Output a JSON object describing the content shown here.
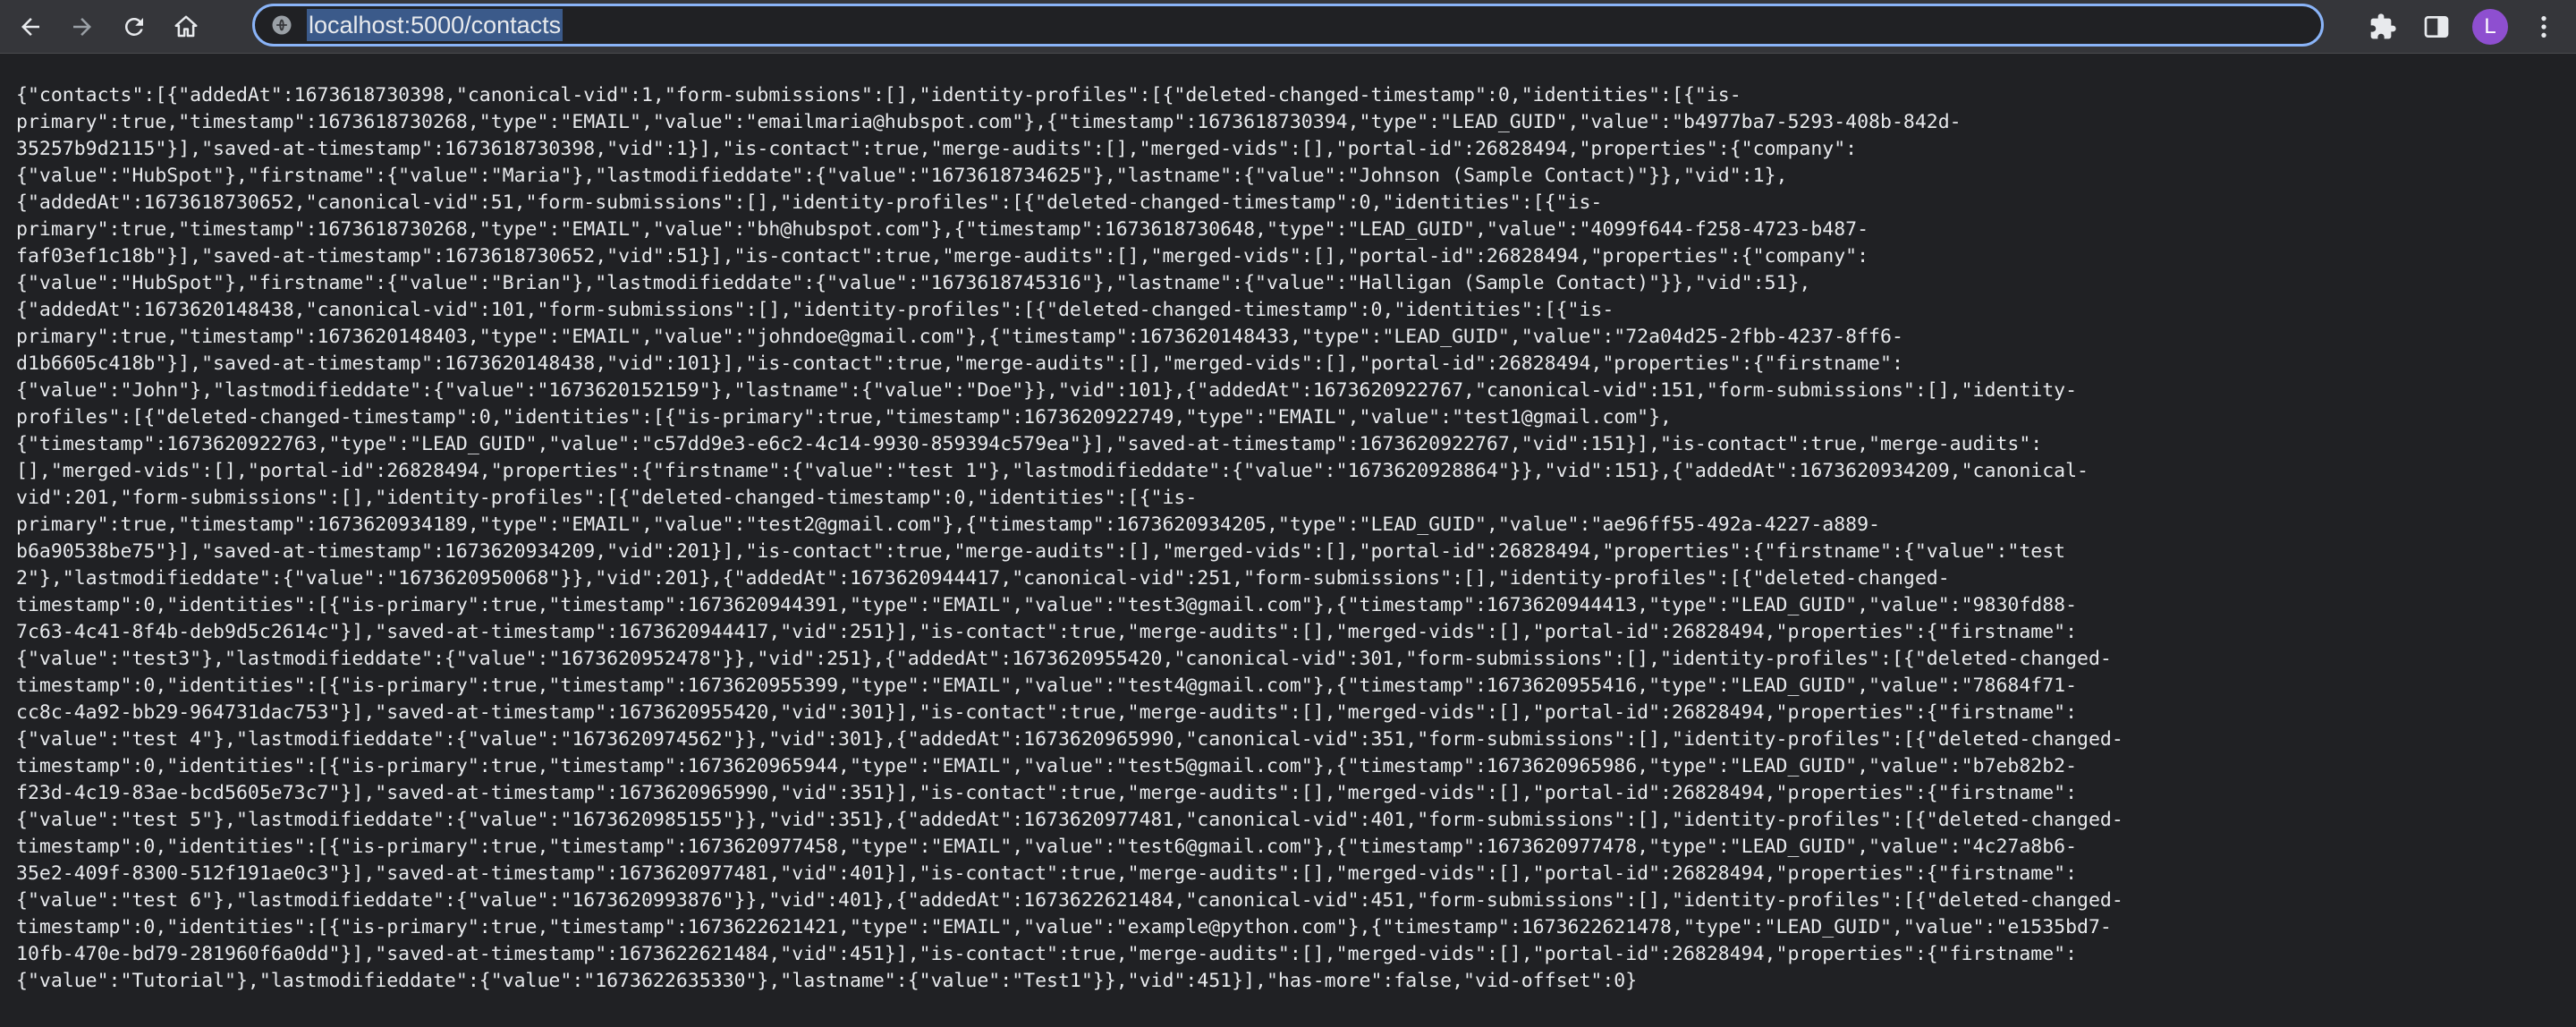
{
  "browser": {
    "url": "localhost:5000/contacts",
    "avatar_letter": "L",
    "icons": {
      "back": "back-arrow-icon",
      "forward": "forward-arrow-icon",
      "reload": "reload-icon",
      "home": "home-icon",
      "site_info": "site-info-icon",
      "extensions": "puzzle-piece-icon",
      "side_panel": "side-panel-icon",
      "menu": "kebab-menu-icon"
    }
  },
  "page": {
    "lines": [
      "{\"contacts\":[{\"addedAt\":1673618730398,\"canonical-vid\":1,\"form-submissions\":[],\"identity-profiles\":[{\"deleted-changed-timestamp\":0,\"identities\":[{\"is-",
      "primary\":true,\"timestamp\":1673618730268,\"type\":\"EMAIL\",\"value\":\"emailmaria@hubspot.com\"},{\"timestamp\":1673618730394,\"type\":\"LEAD_GUID\",\"value\":\"b4977ba7-5293-408b-842d-",
      "35257b9d2115\"}],\"saved-at-timestamp\":1673618730398,\"vid\":1}],\"is-contact\":true,\"merge-audits\":[],\"merged-vids\":[],\"portal-id\":26828494,\"properties\":{\"company\":",
      "{\"value\":\"HubSpot\"},\"firstname\":{\"value\":\"Maria\"},\"lastmodifieddate\":{\"value\":\"1673618734625\"},\"lastname\":{\"value\":\"Johnson (Sample Contact)\"}},\"vid\":1},",
      "{\"addedAt\":1673618730652,\"canonical-vid\":51,\"form-submissions\":[],\"identity-profiles\":[{\"deleted-changed-timestamp\":0,\"identities\":[{\"is-",
      "primary\":true,\"timestamp\":1673618730268,\"type\":\"EMAIL\",\"value\":\"bh@hubspot.com\"},{\"timestamp\":1673618730648,\"type\":\"LEAD_GUID\",\"value\":\"4099f644-f258-4723-b487-",
      "faf03ef1c18b\"}],\"saved-at-timestamp\":1673618730652,\"vid\":51}],\"is-contact\":true,\"merge-audits\":[],\"merged-vids\":[],\"portal-id\":26828494,\"properties\":{\"company\":",
      "{\"value\":\"HubSpot\"},\"firstname\":{\"value\":\"Brian\"},\"lastmodifieddate\":{\"value\":\"1673618745316\"},\"lastname\":{\"value\":\"Halligan (Sample Contact)\"}},\"vid\":51},",
      "{\"addedAt\":1673620148438,\"canonical-vid\":101,\"form-submissions\":[],\"identity-profiles\":[{\"deleted-changed-timestamp\":0,\"identities\":[{\"is-",
      "primary\":true,\"timestamp\":1673620148403,\"type\":\"EMAIL\",\"value\":\"johndoe@gmail.com\"},{\"timestamp\":1673620148433,\"type\":\"LEAD_GUID\",\"value\":\"72a04d25-2fbb-4237-8ff6-",
      "d1b6605c418b\"}],\"saved-at-timestamp\":1673620148438,\"vid\":101}],\"is-contact\":true,\"merge-audits\":[],\"merged-vids\":[],\"portal-id\":26828494,\"properties\":{\"firstname\":",
      "{\"value\":\"John\"},\"lastmodifieddate\":{\"value\":\"1673620152159\"},\"lastname\":{\"value\":\"Doe\"}},\"vid\":101},{\"addedAt\":1673620922767,\"canonical-vid\":151,\"form-submissions\":[],\"identity-",
      "profiles\":[{\"deleted-changed-timestamp\":0,\"identities\":[{\"is-primary\":true,\"timestamp\":1673620922749,\"type\":\"EMAIL\",\"value\":\"test1@gmail.com\"},",
      "{\"timestamp\":1673620922763,\"type\":\"LEAD_GUID\",\"value\":\"c57dd9e3-e6c2-4c14-9930-859394c579ea\"}],\"saved-at-timestamp\":1673620922767,\"vid\":151}],\"is-contact\":true,\"merge-audits\":",
      "[],\"merged-vids\":[],\"portal-id\":26828494,\"properties\":{\"firstname\":{\"value\":\"test 1\"},\"lastmodifieddate\":{\"value\":\"1673620928864\"}},\"vid\":151},{\"addedAt\":1673620934209,\"canonical-",
      "vid\":201,\"form-submissions\":[],\"identity-profiles\":[{\"deleted-changed-timestamp\":0,\"identities\":[{\"is-",
      "primary\":true,\"timestamp\":1673620934189,\"type\":\"EMAIL\",\"value\":\"test2@gmail.com\"},{\"timestamp\":1673620934205,\"type\":\"LEAD_GUID\",\"value\":\"ae96ff55-492a-4227-a889-",
      "b6a90538be75\"}],\"saved-at-timestamp\":1673620934209,\"vid\":201}],\"is-contact\":true,\"merge-audits\":[],\"merged-vids\":[],\"portal-id\":26828494,\"properties\":{\"firstname\":{\"value\":\"test",
      "2\"},\"lastmodifieddate\":{\"value\":\"1673620950068\"}},\"vid\":201},{\"addedAt\":1673620944417,\"canonical-vid\":251,\"form-submissions\":[],\"identity-profiles\":[{\"deleted-changed-",
      "timestamp\":0,\"identities\":[{\"is-primary\":true,\"timestamp\":1673620944391,\"type\":\"EMAIL\",\"value\":\"test3@gmail.com\"},{\"timestamp\":1673620944413,\"type\":\"LEAD_GUID\",\"value\":\"9830fd88-",
      "7c63-4c41-8f4b-deb9d5c2614c\"}],\"saved-at-timestamp\":1673620944417,\"vid\":251}],\"is-contact\":true,\"merge-audits\":[],\"merged-vids\":[],\"portal-id\":26828494,\"properties\":{\"firstname\":",
      "{\"value\":\"test3\"},\"lastmodifieddate\":{\"value\":\"1673620952478\"}},\"vid\":251},{\"addedAt\":1673620955420,\"canonical-vid\":301,\"form-submissions\":[],\"identity-profiles\":[{\"deleted-changed-",
      "timestamp\":0,\"identities\":[{\"is-primary\":true,\"timestamp\":1673620955399,\"type\":\"EMAIL\",\"value\":\"test4@gmail.com\"},{\"timestamp\":1673620955416,\"type\":\"LEAD_GUID\",\"value\":\"78684f71-",
      "cc8c-4a92-bb29-964731dac753\"}],\"saved-at-timestamp\":1673620955420,\"vid\":301}],\"is-contact\":true,\"merge-audits\":[],\"merged-vids\":[],\"portal-id\":26828494,\"properties\":{\"firstname\":",
      "{\"value\":\"test 4\"},\"lastmodifieddate\":{\"value\":\"1673620974562\"}},\"vid\":301},{\"addedAt\":1673620965990,\"canonical-vid\":351,\"form-submissions\":[],\"identity-profiles\":[{\"deleted-changed-",
      "timestamp\":0,\"identities\":[{\"is-primary\":true,\"timestamp\":1673620965944,\"type\":\"EMAIL\",\"value\":\"test5@gmail.com\"},{\"timestamp\":1673620965986,\"type\":\"LEAD_GUID\",\"value\":\"b7eb82b2-",
      "f23d-4c19-83ae-bcd5605e73c7\"}],\"saved-at-timestamp\":1673620965990,\"vid\":351}],\"is-contact\":true,\"merge-audits\":[],\"merged-vids\":[],\"portal-id\":26828494,\"properties\":{\"firstname\":",
      "{\"value\":\"test 5\"},\"lastmodifieddate\":{\"value\":\"1673620985155\"}},\"vid\":351},{\"addedAt\":1673620977481,\"canonical-vid\":401,\"form-submissions\":[],\"identity-profiles\":[{\"deleted-changed-",
      "timestamp\":0,\"identities\":[{\"is-primary\":true,\"timestamp\":1673620977458,\"type\":\"EMAIL\",\"value\":\"test6@gmail.com\"},{\"timestamp\":1673620977478,\"type\":\"LEAD_GUID\",\"value\":\"4c27a8b6-",
      "35e2-409f-8300-512f191ae0c3\"}],\"saved-at-timestamp\":1673620977481,\"vid\":401}],\"is-contact\":true,\"merge-audits\":[],\"merged-vids\":[],\"portal-id\":26828494,\"properties\":{\"firstname\":",
      "{\"value\":\"test 6\"},\"lastmodifieddate\":{\"value\":\"1673620993876\"}},\"vid\":401},{\"addedAt\":1673622621484,\"canonical-vid\":451,\"form-submissions\":[],\"identity-profiles\":[{\"deleted-changed-",
      "timestamp\":0,\"identities\":[{\"is-primary\":true,\"timestamp\":1673622621421,\"type\":\"EMAIL\",\"value\":\"example@python.com\"},{\"timestamp\":1673622621478,\"type\":\"LEAD_GUID\",\"value\":\"e1535bd7-",
      "10fb-470e-bd79-281960f6a0dd\"}],\"saved-at-timestamp\":1673622621484,\"vid\":451}],\"is-contact\":true,\"merge-audits\":[],\"merged-vids\":[],\"portal-id\":26828494,\"properties\":{\"firstname\":",
      "{\"value\":\"Tutorial\"},\"lastmodifieddate\":{\"value\":\"1673622635330\"},\"lastname\":{\"value\":\"Test1\"}},\"vid\":451}],\"has-more\":false,\"vid-offset\":0}"
    ]
  }
}
